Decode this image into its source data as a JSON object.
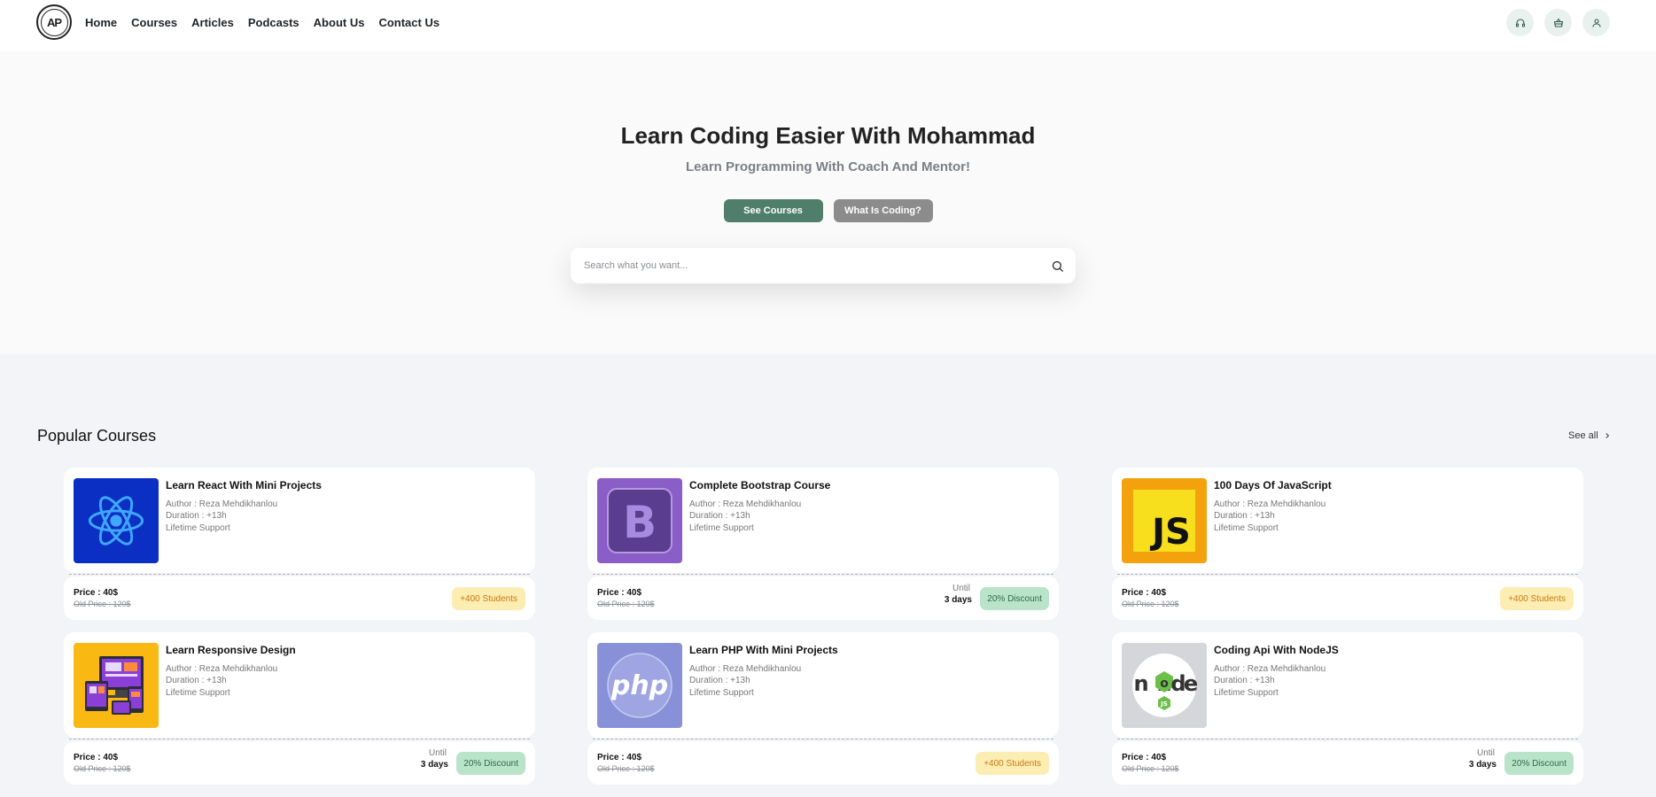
{
  "header": {
    "logo_text": "AP",
    "nav": [
      "Home",
      "Courses",
      "Articles",
      "Podcasts",
      "About Us",
      "Contact Us"
    ],
    "icons": [
      "headphones-icon",
      "basket-icon",
      "user-icon"
    ]
  },
  "hero": {
    "title": "Learn Coding Easier With Mohammad",
    "subtitle": "Learn Programming With Coach And Mentor!",
    "btn_primary": "See Courses",
    "btn_secondary": "What Is Coding?",
    "search_placeholder": "Search what you want..."
  },
  "section": {
    "title": "Popular Courses",
    "see_all": "See all"
  },
  "courses": [
    {
      "title": "Learn React With Mini Projects",
      "author": "Author : Reza Mehdikhanlou",
      "duration": "Duration : +13h",
      "support": "Lifetime Support",
      "price": "Price : 40$",
      "old_price": "Old Price : 120$",
      "badge": "+400 Students",
      "badge_type": "students",
      "until": "",
      "days": "",
      "thumb": "react",
      "thumb_color": "#0b2fc3"
    },
    {
      "title": "Complete Bootstrap Course",
      "author": "Author : Reza Mehdikhanlou",
      "duration": "Duration : +13h",
      "support": "Lifetime Support",
      "price": "Price : 40$",
      "old_price": "Old Price : 120$",
      "badge": "20% Discount",
      "badge_type": "discount",
      "until": "Until",
      "days": "3 days",
      "thumb": "bootstrap",
      "thumb_color": "#8a5dc7"
    },
    {
      "title": "100 Days Of JavaScript",
      "author": "Author : Reza Mehdikhanlou",
      "duration": "Duration : +13h",
      "support": "Lifetime Support",
      "price": "Price : 40$",
      "old_price": "Old Price : 120$",
      "badge": "+400 Students",
      "badge_type": "students",
      "until": "",
      "days": "",
      "thumb": "js",
      "thumb_color": "#f3a20d"
    },
    {
      "title": "Learn Responsive Design",
      "author": "Author : Reza Mehdikhanlou",
      "duration": "Duration : +13h",
      "support": "Lifetime Support",
      "price": "Price : 40$",
      "old_price": "Old Price : 120$",
      "badge": "20% Discount",
      "badge_type": "discount",
      "until": "Until",
      "days": "3 days",
      "thumb": "responsive",
      "thumb_color": "#f9b812"
    },
    {
      "title": "Learn PHP With Mini Projects",
      "author": "Author : Reza Mehdikhanlou",
      "duration": "Duration : +13h",
      "support": "Lifetime Support",
      "price": "Price : 40$",
      "old_price": "Old Price : 120$",
      "badge": "+400 Students",
      "badge_type": "students",
      "until": "",
      "days": "",
      "thumb": "php",
      "thumb_color": "#8890d8"
    },
    {
      "title": "Coding Api With NodeJS",
      "author": "Author : Reza Mehdikhanlou",
      "duration": "Duration : +13h",
      "support": "Lifetime Support",
      "price": "Price : 40$",
      "old_price": "Old Price : 120$",
      "badge": "20% Discount",
      "badge_type": "discount",
      "until": "Until",
      "days": "3 days",
      "thumb": "node",
      "thumb_color": "#d4d6d9"
    }
  ],
  "colors": {
    "accent": "#4f7f6c",
    "secondary_button": "#8c8c8c",
    "students_badge_bg": "#fcedb3",
    "discount_badge_bg": "#b9e4c9",
    "icon_circle_bg": "#e9f1ee"
  }
}
